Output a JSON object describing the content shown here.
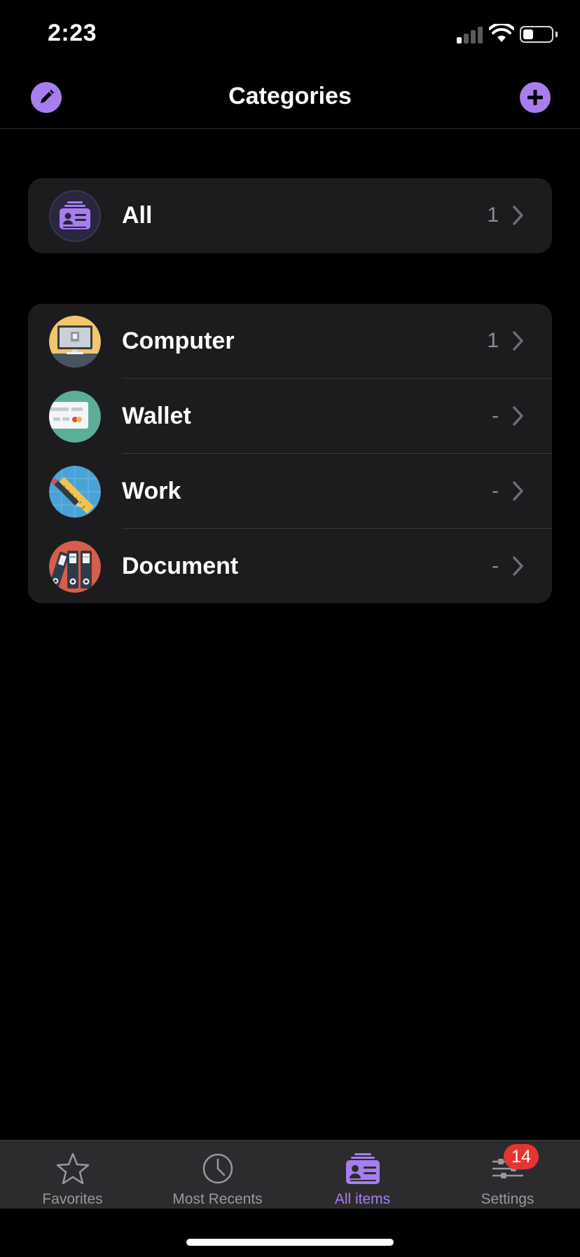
{
  "status_bar": {
    "time": "2:23"
  },
  "nav": {
    "title": "Categories",
    "edit_icon": "pencil-icon",
    "add_icon": "plus-icon"
  },
  "all_group": {
    "label": "All",
    "count": "1",
    "icon": "card-stack-icon"
  },
  "categories": [
    {
      "label": "Computer",
      "count": "1",
      "icon": "computer-icon"
    },
    {
      "label": "Wallet",
      "count": "-",
      "icon": "wallet-icon"
    },
    {
      "label": "Work",
      "count": "-",
      "icon": "work-tools-icon"
    },
    {
      "label": "Document",
      "count": "-",
      "icon": "document-binders-icon"
    }
  ],
  "tabs": [
    {
      "label": "Favorites",
      "icon": "star-icon"
    },
    {
      "label": "Most Recents",
      "icon": "clock-icon"
    },
    {
      "label": "All items",
      "icon": "card-stack-icon",
      "active": true
    },
    {
      "label": "Settings",
      "icon": "sliders-icon"
    }
  ],
  "settings_badge": "14",
  "colors": {
    "accent": "#a77ef0",
    "badge": "#e5352f",
    "group_bg": "#1c1c1e",
    "tab_bg": "#2c2c2e"
  }
}
